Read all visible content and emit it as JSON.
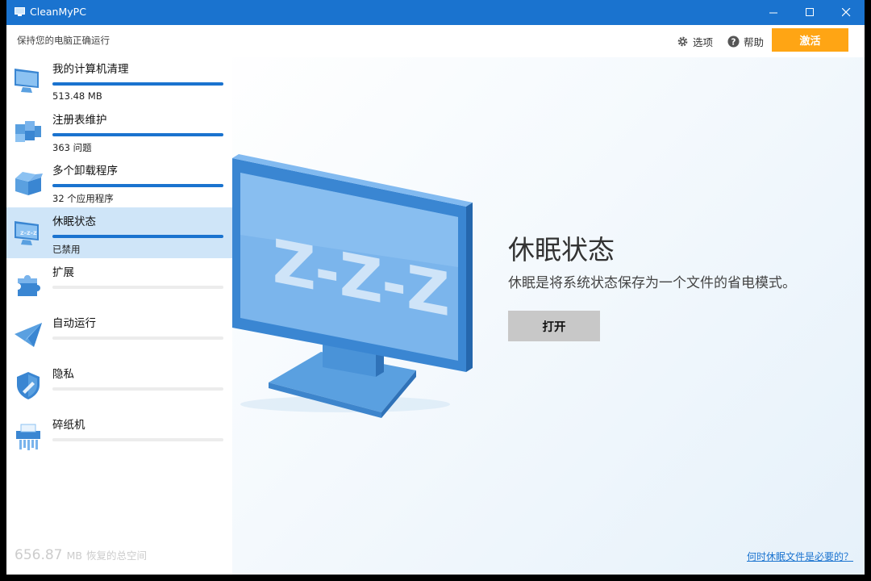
{
  "window": {
    "title": "CleanMyPC"
  },
  "sidebar": {
    "tagline": "保持您的电脑正确运行",
    "items": [
      {
        "label": "我的计算机清理",
        "sub": "513.48 MB",
        "progress": 1.0,
        "active": false,
        "icon": "computer-icon"
      },
      {
        "label": "注册表维护",
        "sub": "363 问题",
        "progress": 1.0,
        "active": false,
        "icon": "registry-cubes-icon"
      },
      {
        "label": "多个卸载程序",
        "sub": "32 个应用程序",
        "progress": 1.0,
        "active": false,
        "icon": "uninstaller-box-icon"
      },
      {
        "label": "休眠状态",
        "sub": "已禁用",
        "progress": 1.0,
        "active": true,
        "icon": "hibernation-monitor-icon"
      },
      {
        "label": "扩展",
        "sub": "",
        "progress": 0.0,
        "active": false,
        "icon": "puzzle-icon"
      },
      {
        "label": "自动运行",
        "sub": "",
        "progress": 0.0,
        "active": false,
        "icon": "paper-plane-icon"
      },
      {
        "label": "隐私",
        "sub": "",
        "progress": 0.0,
        "active": false,
        "icon": "shield-broom-icon"
      },
      {
        "label": "碎纸机",
        "sub": "",
        "progress": 0.0,
        "active": false,
        "icon": "shredder-icon"
      }
    ],
    "footer": {
      "value": "656.87",
      "unit": "MB",
      "label": "恢复的总空间"
    }
  },
  "topbar": {
    "options": "选项",
    "help": "帮助",
    "activate": "激活"
  },
  "main": {
    "feature_title": "休眠状态",
    "feature_desc": "休眠是将系统状态保存为一个文件的省电模式。",
    "open_button": "打开",
    "help_link": "何时休眠文件是必要的？",
    "hero_screen_text": "Z-Z-Z"
  },
  "colors": {
    "titlebar": "#1a73cf",
    "accent": "#1a73cf",
    "activate": "#ffa514",
    "active_item": "#cfe5f8"
  }
}
